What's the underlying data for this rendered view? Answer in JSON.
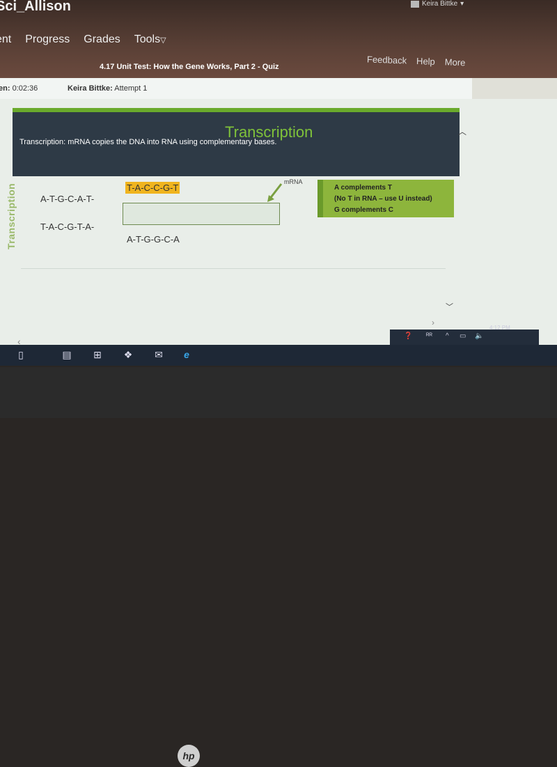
{
  "header": {
    "course_title": "Sci_Allison",
    "user_name": "Keira Bittke",
    "nav": [
      "ent",
      "Progress",
      "Grades",
      "Tools"
    ],
    "right_nav": [
      "Feedback",
      "Help",
      "More"
    ],
    "quiz_title": "4.17 Unit Test: How the Gene Works, Part 2 - Quiz"
  },
  "info": {
    "timer_label": "en:",
    "timer_value": "0:02:36",
    "student_name": "Keira Bittke:",
    "attempt": "Attempt 1"
  },
  "slide": {
    "heading": "Transcription",
    "subtitle": "Transcription: mRNA copies the DNA into RNA using complementary bases.",
    "side_label": "Transcription",
    "strand_top_left": "A-T-G-C-A-T-",
    "strand_top_highlight": "T-A-C-C-G-T",
    "strand_bottom_left": "T-A-C-G-T-A-",
    "strand_bottom_right": "A-T-G-G-C-A",
    "answer_value": "",
    "mrna_label": "mRNA",
    "hint_lines": [
      "A complements T",
      "(No T in RNA – use U instead)",
      "G complements C"
    ]
  },
  "taskbar": {
    "icons": [
      "task-view-icon",
      "file-explorer-icon",
      "store-icon",
      "dropbox-icon",
      "mail-icon",
      "internet-explorer-icon"
    ],
    "clock": "4:12 PM"
  },
  "colors": {
    "banner_bg": "#2e3a46",
    "accent_green": "#6aaa2c",
    "highlight_yellow": "#f0b41e",
    "hint_green": "#8db53c"
  },
  "device": {
    "brand": "hp"
  }
}
